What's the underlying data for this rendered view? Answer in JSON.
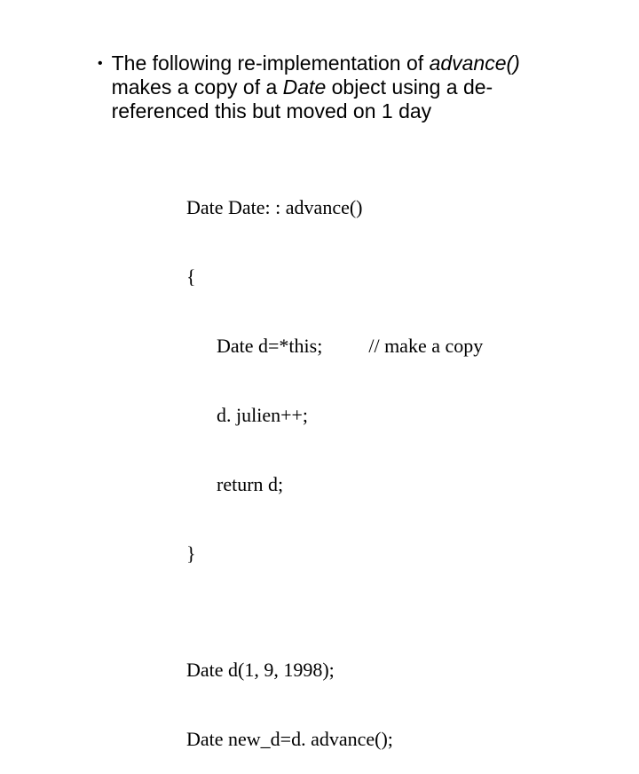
{
  "bullet": {
    "pre1": "The following re-implementation of ",
    "em1": "advance()",
    "pre2": " makes a copy of a ",
    "em2": "Date",
    "post": " object using a de-referenced this but moved on 1 day"
  },
  "code": {
    "l1": "Date Date: : advance()",
    "l2": "{",
    "l3a": "Date d=*this;",
    "l3b": "// make a copy",
    "l4": "d. julien++;",
    "l5": "return d;",
    "l6": "}",
    "u1": "Date d(1, 9, 1998);",
    "u2": "Date new_d=d. advance();"
  }
}
